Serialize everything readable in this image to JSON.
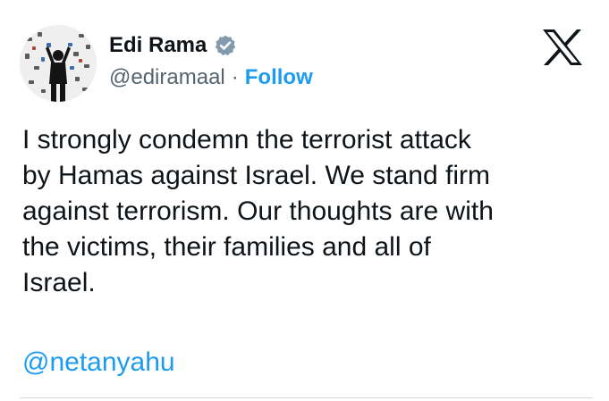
{
  "tweet": {
    "author": {
      "display_name": "Edi Rama",
      "handle": "@ediramaal",
      "verified_icon": "verified-badge-icon",
      "verified_color": "#829aab"
    },
    "separator": "·",
    "follow_label": "Follow",
    "follow_color": "#1d9bf0",
    "platform_icon": "x-logo-icon",
    "text": "I strongly condemn the terrorist attack\nby Hamas against Israel. We stand firm\nagainst terrorism. Our thoughts are with\nthe victims, their families and all of\nIsrael.",
    "mention": "@netanyahu",
    "mention_color": "#1d9bf0"
  }
}
